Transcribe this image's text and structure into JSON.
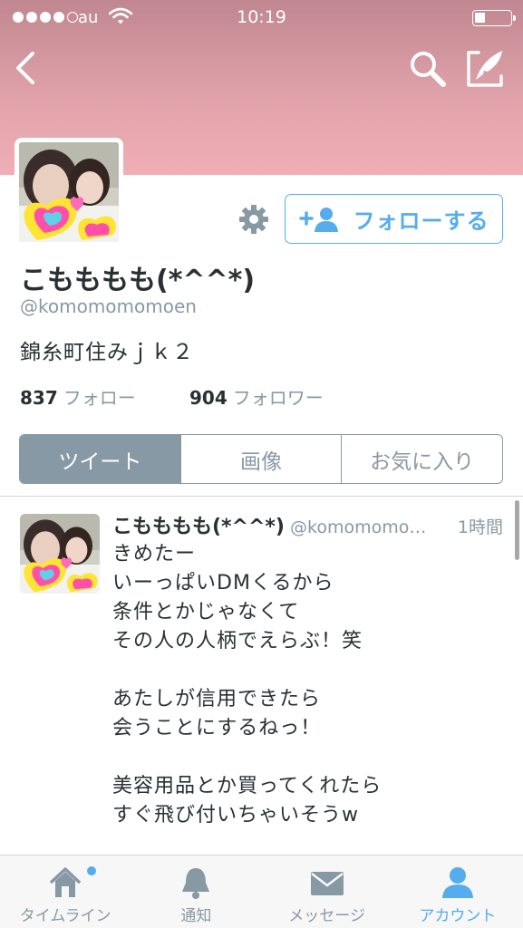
{
  "status_bar": {
    "carrier": "au",
    "time": "10:19",
    "signal_bars_filled": 4,
    "signal_bars_total": 5,
    "battery_level": 0.3
  },
  "nav": {
    "back_icon": "chevron-left-icon",
    "search_icon": "search-icon",
    "compose_icon": "compose-icon"
  },
  "profile": {
    "display_name": "こもももも(*^^*)",
    "screen_name": "@komomomomoen",
    "bio": "錦糸町住みｊｋ２",
    "following_count": "837",
    "following_label": "フォロー",
    "followers_count": "904",
    "followers_label": "フォロワー",
    "follow_button_label": "フォローする"
  },
  "segments": {
    "tweets": "ツイート",
    "media": "画像",
    "favorites": "お気に入り",
    "active": "tweets"
  },
  "tweet": {
    "author_name": "こもももも(*^^*)",
    "author_handle": "@komomomo…",
    "time": "1時間",
    "lines": [
      "きめたー",
      "いーっぱいDMくるから",
      "条件とかじゃなくて",
      "その人の人柄でえらぶ！笑",
      "",
      "あたしが信用できたら",
      "会うことにするねっ！",
      "",
      "美容用品とか買ってくれたら",
      "すぐ飛び付いちゃいそうw"
    ]
  },
  "tab_bar": {
    "timeline": "タイムライン",
    "notifications": "通知",
    "messages": "メッセージ",
    "account": "アカウント",
    "active": "account"
  },
  "colors": {
    "accent": "#55acee",
    "muted": "#8899a6",
    "header_pink": "#e0a2aa",
    "text": "#292f33"
  }
}
